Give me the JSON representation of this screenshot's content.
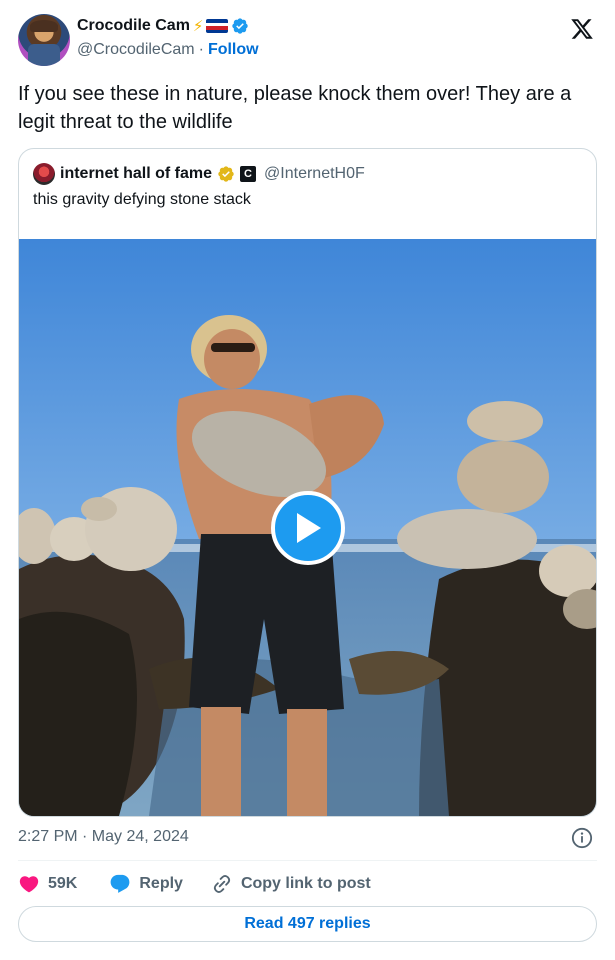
{
  "author": {
    "display_name": "Crocodile Cam",
    "emoji_icon": "lightning-bolt-icon",
    "flag_icon": "flag-icon",
    "handle": "@CrocodileCam",
    "separator": "·",
    "follow_label": "Follow"
  },
  "tweet": {
    "text": "If you see these in nature, please knock them over! They are a legit threat to the wildlife"
  },
  "quote": {
    "display_name": "internet hall of fame",
    "handle": "@InternetH0F",
    "square_badge": "C",
    "text": "this gravity defying stone stack"
  },
  "meta": {
    "timestamp": "2:27 PM · May 24, 2024"
  },
  "actions": {
    "likes": "59K",
    "reply_label": "Reply",
    "copy_label": "Copy link to post"
  },
  "footer": {
    "read_replies_label": "Read 497 replies"
  },
  "colors": {
    "link_blue": "#006fd6",
    "verified_blue": "#1d9bf0",
    "like_pink": "#f91880",
    "muted_text": "#536471"
  }
}
